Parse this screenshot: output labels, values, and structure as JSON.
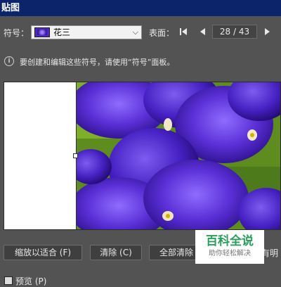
{
  "window": {
    "title": "贴图"
  },
  "symbol": {
    "label": "符号：",
    "selected": "花三"
  },
  "face": {
    "label": "表面：",
    "page": "28 / 43"
  },
  "info": {
    "text": "要创建和编辑这些符号，请使用“符号”面板。"
  },
  "buttons": {
    "fit": "缩放以适合 (F)",
    "clear": "清除 (C)",
    "clear_all": "全部清除",
    "partial": "有明"
  },
  "preview_option": {
    "label": "预览 (P)"
  },
  "watermark": {
    "brand": "百科全说",
    "slogan": "助你轻松解决"
  },
  "colors": {
    "panel": "#535353",
    "titlebar": "#0b246a",
    "flower": "#4b2bb8"
  }
}
